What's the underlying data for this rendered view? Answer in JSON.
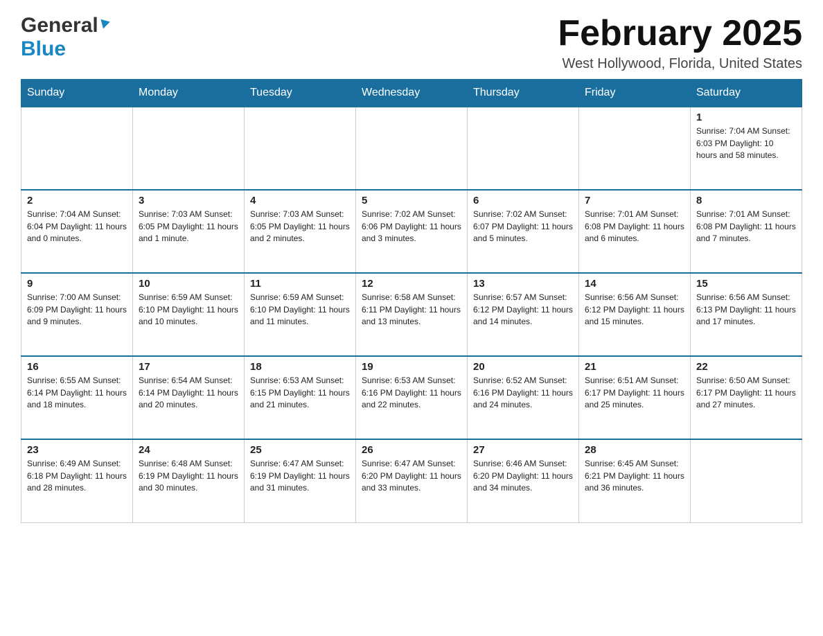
{
  "header": {
    "logo_general": "General",
    "logo_blue": "Blue",
    "month_title": "February 2025",
    "location": "West Hollywood, Florida, United States"
  },
  "calendar": {
    "days_of_week": [
      "Sunday",
      "Monday",
      "Tuesday",
      "Wednesday",
      "Thursday",
      "Friday",
      "Saturday"
    ],
    "weeks": [
      {
        "days": [
          {
            "num": "",
            "info": ""
          },
          {
            "num": "",
            "info": ""
          },
          {
            "num": "",
            "info": ""
          },
          {
            "num": "",
            "info": ""
          },
          {
            "num": "",
            "info": ""
          },
          {
            "num": "",
            "info": ""
          },
          {
            "num": "1",
            "info": "Sunrise: 7:04 AM\nSunset: 6:03 PM\nDaylight: 10 hours\nand 58 minutes."
          }
        ]
      },
      {
        "days": [
          {
            "num": "2",
            "info": "Sunrise: 7:04 AM\nSunset: 6:04 PM\nDaylight: 11 hours\nand 0 minutes."
          },
          {
            "num": "3",
            "info": "Sunrise: 7:03 AM\nSunset: 6:05 PM\nDaylight: 11 hours\nand 1 minute."
          },
          {
            "num": "4",
            "info": "Sunrise: 7:03 AM\nSunset: 6:05 PM\nDaylight: 11 hours\nand 2 minutes."
          },
          {
            "num": "5",
            "info": "Sunrise: 7:02 AM\nSunset: 6:06 PM\nDaylight: 11 hours\nand 3 minutes."
          },
          {
            "num": "6",
            "info": "Sunrise: 7:02 AM\nSunset: 6:07 PM\nDaylight: 11 hours\nand 5 minutes."
          },
          {
            "num": "7",
            "info": "Sunrise: 7:01 AM\nSunset: 6:08 PM\nDaylight: 11 hours\nand 6 minutes."
          },
          {
            "num": "8",
            "info": "Sunrise: 7:01 AM\nSunset: 6:08 PM\nDaylight: 11 hours\nand 7 minutes."
          }
        ]
      },
      {
        "days": [
          {
            "num": "9",
            "info": "Sunrise: 7:00 AM\nSunset: 6:09 PM\nDaylight: 11 hours\nand 9 minutes."
          },
          {
            "num": "10",
            "info": "Sunrise: 6:59 AM\nSunset: 6:10 PM\nDaylight: 11 hours\nand 10 minutes."
          },
          {
            "num": "11",
            "info": "Sunrise: 6:59 AM\nSunset: 6:10 PM\nDaylight: 11 hours\nand 11 minutes."
          },
          {
            "num": "12",
            "info": "Sunrise: 6:58 AM\nSunset: 6:11 PM\nDaylight: 11 hours\nand 13 minutes."
          },
          {
            "num": "13",
            "info": "Sunrise: 6:57 AM\nSunset: 6:12 PM\nDaylight: 11 hours\nand 14 minutes."
          },
          {
            "num": "14",
            "info": "Sunrise: 6:56 AM\nSunset: 6:12 PM\nDaylight: 11 hours\nand 15 minutes."
          },
          {
            "num": "15",
            "info": "Sunrise: 6:56 AM\nSunset: 6:13 PM\nDaylight: 11 hours\nand 17 minutes."
          }
        ]
      },
      {
        "days": [
          {
            "num": "16",
            "info": "Sunrise: 6:55 AM\nSunset: 6:14 PM\nDaylight: 11 hours\nand 18 minutes."
          },
          {
            "num": "17",
            "info": "Sunrise: 6:54 AM\nSunset: 6:14 PM\nDaylight: 11 hours\nand 20 minutes."
          },
          {
            "num": "18",
            "info": "Sunrise: 6:53 AM\nSunset: 6:15 PM\nDaylight: 11 hours\nand 21 minutes."
          },
          {
            "num": "19",
            "info": "Sunrise: 6:53 AM\nSunset: 6:16 PM\nDaylight: 11 hours\nand 22 minutes."
          },
          {
            "num": "20",
            "info": "Sunrise: 6:52 AM\nSunset: 6:16 PM\nDaylight: 11 hours\nand 24 minutes."
          },
          {
            "num": "21",
            "info": "Sunrise: 6:51 AM\nSunset: 6:17 PM\nDaylight: 11 hours\nand 25 minutes."
          },
          {
            "num": "22",
            "info": "Sunrise: 6:50 AM\nSunset: 6:17 PM\nDaylight: 11 hours\nand 27 minutes."
          }
        ]
      },
      {
        "days": [
          {
            "num": "23",
            "info": "Sunrise: 6:49 AM\nSunset: 6:18 PM\nDaylight: 11 hours\nand 28 minutes."
          },
          {
            "num": "24",
            "info": "Sunrise: 6:48 AM\nSunset: 6:19 PM\nDaylight: 11 hours\nand 30 minutes."
          },
          {
            "num": "25",
            "info": "Sunrise: 6:47 AM\nSunset: 6:19 PM\nDaylight: 11 hours\nand 31 minutes."
          },
          {
            "num": "26",
            "info": "Sunrise: 6:47 AM\nSunset: 6:20 PM\nDaylight: 11 hours\nand 33 minutes."
          },
          {
            "num": "27",
            "info": "Sunrise: 6:46 AM\nSunset: 6:20 PM\nDaylight: 11 hours\nand 34 minutes."
          },
          {
            "num": "28",
            "info": "Sunrise: 6:45 AM\nSunset: 6:21 PM\nDaylight: 11 hours\nand 36 minutes."
          },
          {
            "num": "",
            "info": ""
          }
        ]
      }
    ]
  }
}
